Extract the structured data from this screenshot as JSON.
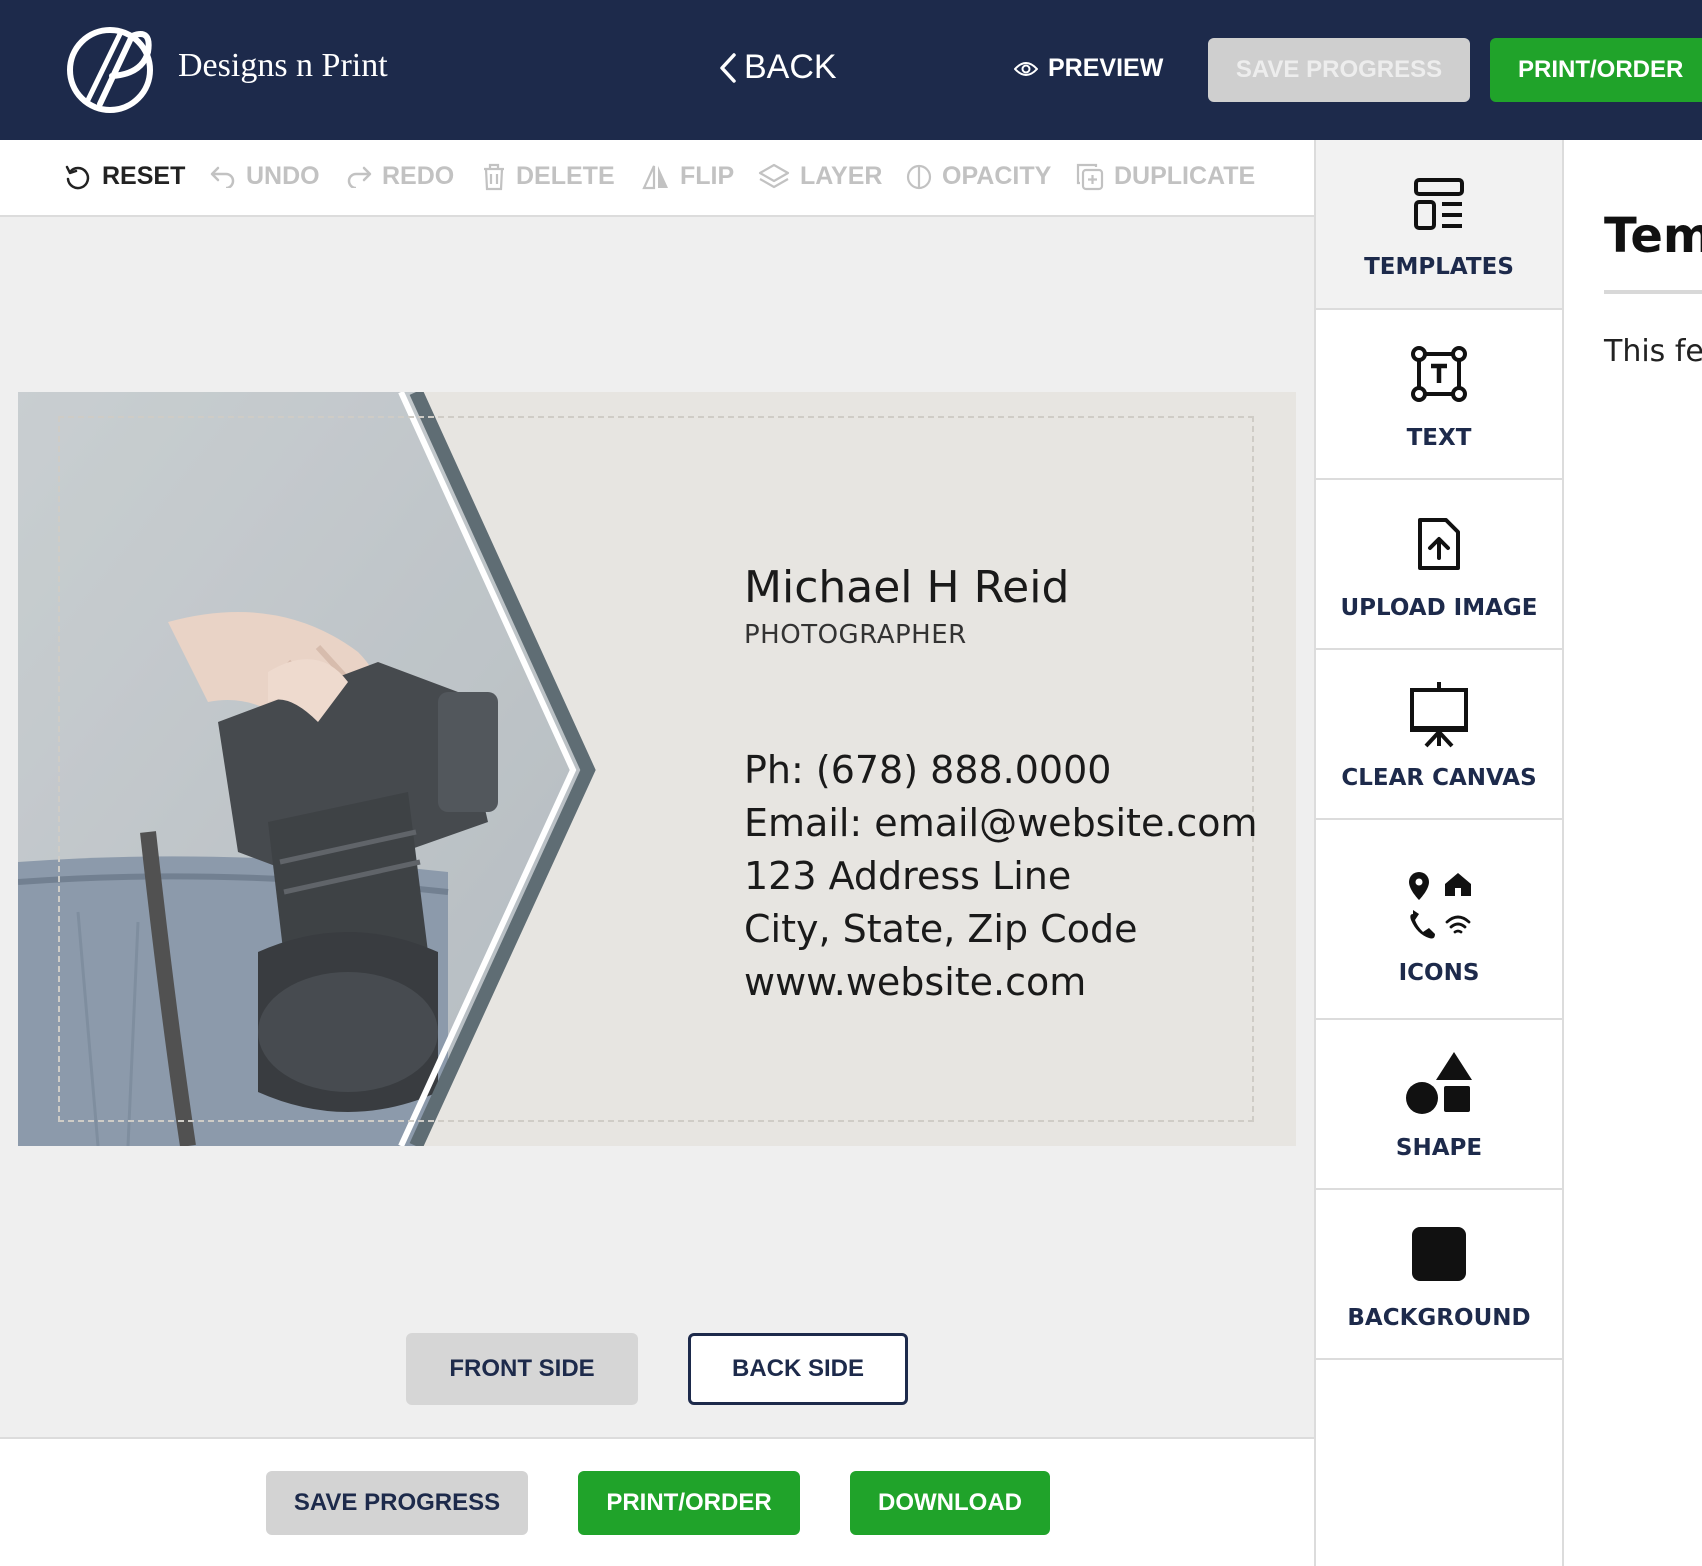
{
  "brand": {
    "name": "Designs n Print"
  },
  "header": {
    "back_label": "BACK",
    "preview_label": "PREVIEW",
    "save_label": "SAVE PROGRESS",
    "print_label": "PRINT/ORDER"
  },
  "toolbar": {
    "reset": "RESET",
    "undo": "UNDO",
    "redo": "REDO",
    "delete": "DELETE",
    "flip": "FLIP",
    "layer": "LAYER",
    "opacity": "OPACITY",
    "duplicate": "DUPLICATE"
  },
  "card": {
    "name": "Michael H Reid",
    "title": "PHOTOGRAPHER",
    "phone": "Ph: (678) 888.0000",
    "email": "Email: email@website.com",
    "address": "123 Address Line",
    "city": "City, State, Zip Code",
    "website": "www.website.com"
  },
  "sides": {
    "front": "FRONT SIDE",
    "back": "BACK SIDE"
  },
  "bottom_bar": {
    "save": "SAVE PROGRESS",
    "print": "PRINT/ORDER",
    "download": "DOWNLOAD"
  },
  "sidebar": {
    "items": [
      {
        "label": "TEMPLATES",
        "icon": "templates-icon"
      },
      {
        "label": "TEXT",
        "icon": "text-icon"
      },
      {
        "label": "UPLOAD IMAGE",
        "icon": "upload-image-icon"
      },
      {
        "label": "CLEAR CANVAS",
        "icon": "clear-canvas-icon"
      },
      {
        "label": "ICONS",
        "icon": "icons-icon"
      },
      {
        "label": "SHAPE",
        "icon": "shape-icon"
      },
      {
        "label": "BACKGROUND",
        "icon": "background-icon"
      }
    ]
  },
  "panel": {
    "title": "Temp",
    "text": "This fea"
  },
  "colors": {
    "header_bg": "#1d2a4b",
    "accent_green": "#20a32a",
    "disabled_gray": "#cfcfcf"
  }
}
